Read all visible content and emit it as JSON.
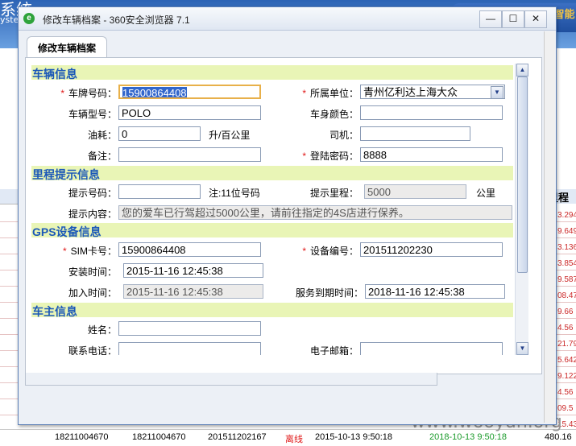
{
  "background": {
    "logo_line1": "系统",
    "logo_line2": "ystem",
    "gps_label": "GPS智能",
    "column_header_right": "里程",
    "right_values": [
      "3.294",
      "9.649",
      "3.136",
      "3.854",
      "9.587",
      "08.47",
      "9.66",
      "4.56",
      "21.79",
      "5.642",
      "9.122",
      "4.56",
      "09.5",
      "15.43"
    ],
    "bottom_row": {
      "col1": "18211004670",
      "col2": "18211004670",
      "col3": "201511202167",
      "status": "离线",
      "time1": "2015-10-13 9:50:18",
      "time2": "2018-10-13 9:50:18",
      "mileage": "480.16"
    },
    "watermark": "www.wooyun.org"
  },
  "window": {
    "title": "修改车辆档案 - 360安全浏览器 7.1",
    "min_glyph": "—",
    "max_glyph": "☐",
    "close_glyph": "✕"
  },
  "tab": {
    "label": "修改车辆档案"
  },
  "sections": {
    "vehicle": "车辆信息",
    "mileage": "里程提示信息",
    "gps": "GPS设备信息",
    "owner": "车主信息"
  },
  "required_mark": "*",
  "form": {
    "plate_label": "车牌号码：",
    "plate_value": "15900864408",
    "unit_label": "所属单位：",
    "unit_value": "青州亿利达上海大众",
    "model_label": "车辆型号：",
    "model_value": "POLO",
    "color_label": "车身颜色：",
    "color_value": "",
    "fuel_label": "油耗：",
    "fuel_value": "0",
    "fuel_unit": "升/百公里",
    "driver_label": "司机：",
    "driver_value": "",
    "remark_label": "备注：",
    "remark_value": "",
    "password_label": "登陆密码：",
    "password_value": "8888",
    "notify_phone_label": "提示号码：",
    "notify_phone_value": "",
    "notify_phone_note": "注:11位号码",
    "notify_mileage_label": "提示里程：",
    "notify_mileage_value": "5000",
    "notify_mileage_unit": "公里",
    "notify_content_label": "提示内容：",
    "notify_content_value": "您的爱车已行驾超过5000公里，请前往指定的4S店进行保养。",
    "sim_label": "SIM卡号：",
    "sim_value": "15900864408",
    "device_label": "设备编号：",
    "device_value": "201511202230",
    "install_label": "安装时间：",
    "install_value": "2015-11-16 12:45:38",
    "join_label": "加入时间：",
    "join_value": "2015-11-16 12:45:38",
    "expire_label": "服务到期时间：",
    "expire_value": "2018-11-16 12:45:38",
    "owner_name_label": "姓名：",
    "owner_name_value": "",
    "owner_phone_label": "联系电话：",
    "owner_phone_value": "",
    "owner_email_label": "电子邮箱：",
    "owner_email_value": ""
  }
}
